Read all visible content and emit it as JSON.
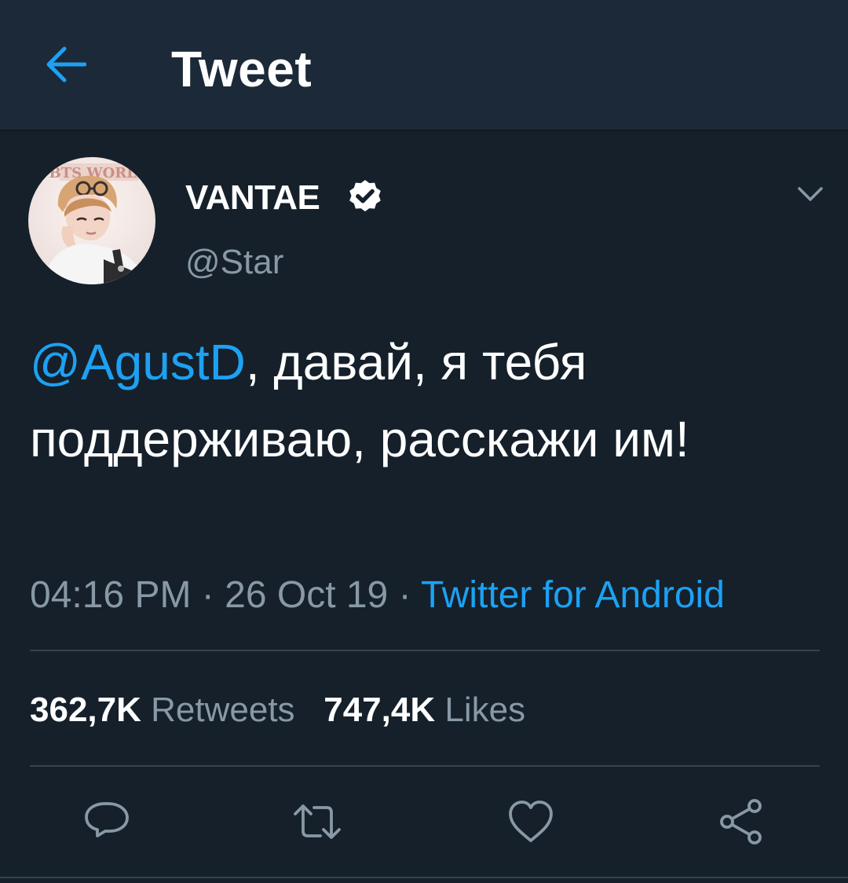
{
  "header": {
    "title": "Tweet",
    "back_icon": "arrow-left-icon"
  },
  "tweet": {
    "author": {
      "display_name": "VANTAE",
      "handle": "@Star",
      "verified": true,
      "avatar_text": "BTS WORLD"
    },
    "mention": "@AgustD",
    "text": ", давай, я тебя поддерживаю, расскажи им!",
    "time": "04:16 PM",
    "separator": "·",
    "date": "26 Oct 19",
    "source": "Twitter for Android",
    "retweets_count": "362,7K",
    "retweets_label": "Retweets",
    "likes_count": "747,4K",
    "likes_label": "Likes"
  },
  "actions": [
    "reply-icon",
    "retweet-icon",
    "like-icon",
    "share-icon"
  ],
  "colors": {
    "background": "#15202b",
    "header_background": "#1c2938",
    "accent": "#1da1f2",
    "secondary_text": "#8899a6",
    "divider": "#38444d"
  }
}
